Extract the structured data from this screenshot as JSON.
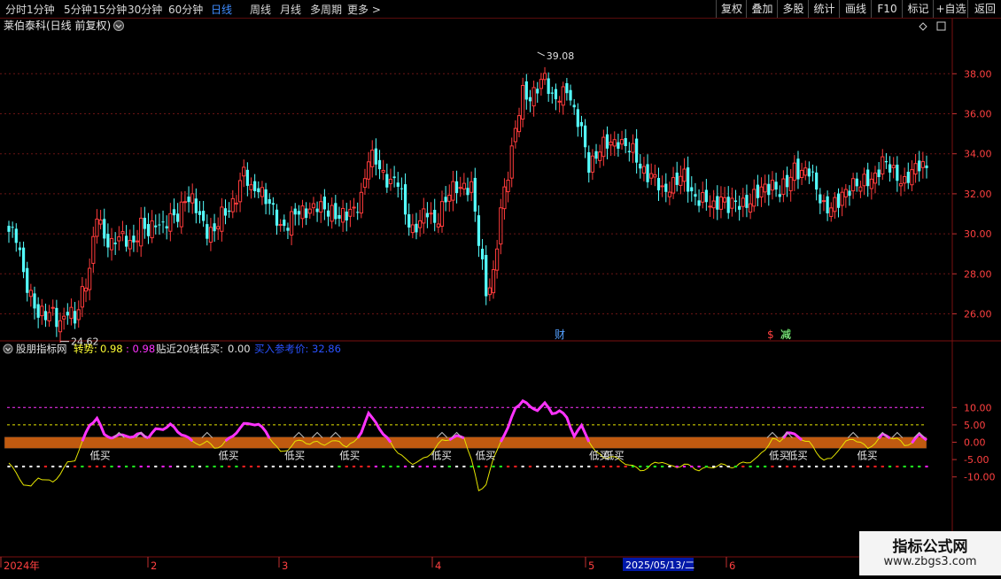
{
  "toolbar": {
    "periods": [
      "分时",
      "1分钟",
      "5分钟",
      "15分钟",
      "30分钟",
      "60分钟",
      "日线",
      "周线",
      "月线",
      "多周期",
      "更多 >"
    ],
    "active_period": "日线",
    "right_buttons": [
      "复权",
      "叠加",
      "多股",
      "统计",
      "画线",
      "F10",
      "标记",
      "+自选",
      "返回"
    ]
  },
  "stock_title": "莱伯泰科(日线 前复权)",
  "price_axis": {
    "ticks": [
      38.0,
      36.0,
      34.0,
      32.0,
      30.0,
      28.0,
      26.0
    ],
    "min": 24.6,
    "max": 39.2
  },
  "markers": {
    "high_label": "39.08",
    "low_label": "24.62",
    "event1": "财",
    "event2": "$",
    "event3": "减"
  },
  "indicator": {
    "name": "股朋指标网",
    "turn_label": "转势:",
    "turn_v1": "0.98",
    "turn_v2": ": 0.98",
    "near20_label": "贴近20线低买:",
    "near20_value": "0.00",
    "buy_ref_label": "买入参考价:",
    "buy_ref_value": "32.86",
    "axis_ticks": [
      10.0,
      5.0,
      0.0,
      -5.0,
      -10.0
    ],
    "buy_tag": "低买",
    "buy_tag_days": [
      24,
      59,
      77,
      92,
      117,
      129,
      160,
      164,
      209,
      214,
      233
    ]
  },
  "date_axis": {
    "labels": [
      "2024年",
      "2",
      "3",
      "4",
      "5",
      "6"
    ],
    "highlight": "2025/05/13/二"
  },
  "colors": {
    "up": "#ff3b3b",
    "down": "#54ffff",
    "turn_line": "#ff33ff",
    "thin_line": "#e6e600",
    "band": "#c05a10"
  },
  "watermark": {
    "title": "指标公式网",
    "url": "www.zbgs3.com"
  },
  "chart_data": {
    "type": "candlestick",
    "anchor_closes": [
      [
        0,
        30.1
      ],
      [
        2,
        29.7
      ],
      [
        4,
        28.1
      ],
      [
        6,
        27.0
      ],
      [
        8,
        25.8
      ],
      [
        10,
        25.9
      ],
      [
        12,
        26.3
      ],
      [
        14,
        25.4
      ],
      [
        16,
        26.0
      ],
      [
        18,
        25.8
      ],
      [
        20,
        27.2
      ],
      [
        22,
        28.0
      ],
      [
        24,
        31.0
      ],
      [
        26,
        30.0
      ],
      [
        28,
        29.4
      ],
      [
        30,
        29.7
      ],
      [
        32,
        29.8
      ],
      [
        34,
        29.6
      ],
      [
        36,
        30.3
      ],
      [
        38,
        30.0
      ],
      [
        40,
        30.8
      ],
      [
        42,
        30.3
      ],
      [
        44,
        30.6
      ],
      [
        46,
        31.0
      ],
      [
        48,
        31.9
      ],
      [
        50,
        31.5
      ],
      [
        52,
        30.8
      ],
      [
        54,
        30.3
      ],
      [
        56,
        30.1
      ],
      [
        58,
        30.8
      ],
      [
        60,
        31.3
      ],
      [
        62,
        32.0
      ],
      [
        64,
        33.0
      ],
      [
        66,
        32.1
      ],
      [
        68,
        32.5
      ],
      [
        70,
        31.7
      ],
      [
        72,
        31.0
      ],
      [
        74,
        30.4
      ],
      [
        76,
        30.6
      ],
      [
        78,
        30.9
      ],
      [
        80,
        31.0
      ],
      [
        82,
        31.4
      ],
      [
        84,
        31.4
      ],
      [
        86,
        31.0
      ],
      [
        88,
        31.2
      ],
      [
        90,
        31.0
      ],
      [
        92,
        30.8
      ],
      [
        94,
        31.1
      ],
      [
        96,
        32.0
      ],
      [
        98,
        33.8
      ],
      [
        100,
        33.5
      ],
      [
        102,
        33.0
      ],
      [
        104,
        32.7
      ],
      [
        106,
        32.5
      ],
      [
        108,
        31.0
      ],
      [
        110,
        30.3
      ],
      [
        112,
        30.6
      ],
      [
        114,
        31.0
      ],
      [
        116,
        30.6
      ],
      [
        118,
        31.4
      ],
      [
        120,
        31.9
      ],
      [
        122,
        32.3
      ],
      [
        124,
        32.5
      ],
      [
        126,
        32.3
      ],
      [
        128,
        29.5
      ],
      [
        130,
        27.2
      ],
      [
        132,
        28.0
      ],
      [
        134,
        31.0
      ],
      [
        136,
        33.0
      ],
      [
        138,
        35.5
      ],
      [
        140,
        37.0
      ],
      [
        142,
        36.5
      ],
      [
        144,
        37.5
      ],
      [
        146,
        38.0
      ],
      [
        148,
        36.5
      ],
      [
        150,
        36.8
      ],
      [
        152,
        37.5
      ],
      [
        154,
        36.0
      ],
      [
        156,
        35.0
      ],
      [
        158,
        33.5
      ],
      [
        160,
        34.0
      ],
      [
        162,
        34.3
      ],
      [
        164,
        34.5
      ],
      [
        166,
        34.8
      ],
      [
        168,
        34.3
      ],
      [
        170,
        34.0
      ],
      [
        172,
        33.5
      ],
      [
        174,
        33.0
      ],
      [
        176,
        32.6
      ],
      [
        178,
        32.1
      ],
      [
        180,
        32.5
      ],
      [
        182,
        32.6
      ],
      [
        184,
        32.8
      ],
      [
        186,
        32.1
      ],
      [
        188,
        31.8
      ],
      [
        190,
        31.5
      ],
      [
        192,
        31.3
      ],
      [
        194,
        32.0
      ],
      [
        196,
        31.3
      ],
      [
        198,
        31.4
      ],
      [
        200,
        31.6
      ],
      [
        202,
        31.7
      ],
      [
        204,
        31.9
      ],
      [
        206,
        32.3
      ],
      [
        208,
        32.6
      ],
      [
        210,
        32.0
      ],
      [
        212,
        32.4
      ],
      [
        214,
        33.4
      ],
      [
        216,
        33.1
      ],
      [
        218,
        33.0
      ],
      [
        220,
        32.3
      ],
      [
        222,
        31.5
      ],
      [
        224,
        31.2
      ],
      [
        226,
        31.5
      ],
      [
        228,
        32.3
      ],
      [
        230,
        32.5
      ],
      [
        232,
        32.3
      ],
      [
        234,
        32.7
      ],
      [
        236,
        33.0
      ],
      [
        238,
        33.5
      ],
      [
        240,
        33.2
      ],
      [
        242,
        33.0
      ],
      [
        244,
        32.6
      ],
      [
        246,
        32.9
      ],
      [
        248,
        33.5
      ],
      [
        250,
        33.5
      ]
    ],
    "high": 39.08,
    "low": 24.62,
    "indicator_thin_anchors": [
      [
        0,
        -6
      ],
      [
        2,
        -9
      ],
      [
        4,
        -12
      ],
      [
        6,
        -13
      ],
      [
        8,
        -10
      ],
      [
        10,
        -11
      ],
      [
        12,
        -11.5
      ],
      [
        14,
        -9
      ],
      [
        16,
        -6
      ],
      [
        18,
        -5
      ],
      [
        20,
        0
      ],
      [
        22,
        5
      ],
      [
        24,
        7
      ],
      [
        26,
        2
      ],
      [
        28,
        1.5
      ],
      [
        30,
        1.8
      ],
      [
        32,
        2
      ],
      [
        34,
        1.5
      ],
      [
        36,
        2.5
      ],
      [
        38,
        1.5
      ],
      [
        40,
        3.5
      ],
      [
        42,
        4
      ],
      [
        44,
        5
      ],
      [
        46,
        3
      ],
      [
        48,
        2
      ],
      [
        50,
        0
      ],
      [
        52,
        -0.5
      ],
      [
        54,
        0
      ],
      [
        56,
        -1.5
      ],
      [
        58,
        -1
      ],
      [
        60,
        1
      ],
      [
        62,
        3
      ],
      [
        64,
        5
      ],
      [
        66,
        5.5
      ],
      [
        68,
        5
      ],
      [
        70,
        3
      ],
      [
        72,
        0
      ],
      [
        74,
        -3
      ],
      [
        76,
        -2
      ],
      [
        78,
        0
      ],
      [
        80,
        0.5
      ],
      [
        82,
        -0.5
      ],
      [
        84,
        0
      ],
      [
        86,
        -0.5
      ],
      [
        88,
        0
      ],
      [
        90,
        0.5
      ],
      [
        92,
        -1.5
      ],
      [
        94,
        0
      ],
      [
        96,
        3
      ],
      [
        98,
        8
      ],
      [
        100,
        6
      ],
      [
        102,
        2
      ],
      [
        104,
        0
      ],
      [
        106,
        -3
      ],
      [
        108,
        -5
      ],
      [
        110,
        -6
      ],
      [
        112,
        -5.5
      ],
      [
        114,
        -4
      ],
      [
        116,
        -2
      ],
      [
        118,
        0.5
      ],
      [
        120,
        1
      ],
      [
        122,
        1.5
      ],
      [
        124,
        1.5
      ],
      [
        126,
        -5
      ],
      [
        128,
        -14
      ],
      [
        130,
        -12
      ],
      [
        132,
        -5
      ],
      [
        134,
        0.5
      ],
      [
        136,
        4
      ],
      [
        138,
        10
      ],
      [
        140,
        12
      ],
      [
        142,
        10
      ],
      [
        144,
        9.5
      ],
      [
        146,
        11
      ],
      [
        148,
        8.5
      ],
      [
        150,
        9
      ],
      [
        152,
        7
      ],
      [
        154,
        2
      ],
      [
        156,
        4.5
      ],
      [
        158,
        0.5
      ],
      [
        160,
        -3
      ],
      [
        162,
        -4.5
      ],
      [
        164,
        -4
      ],
      [
        166,
        -5
      ],
      [
        168,
        -6
      ],
      [
        170,
        -7
      ],
      [
        172,
        -8
      ],
      [
        174,
        -7.5
      ],
      [
        176,
        -6
      ],
      [
        178,
        -5.5
      ],
      [
        180,
        -7
      ],
      [
        182,
        -7
      ],
      [
        184,
        -6.5
      ],
      [
        186,
        -7
      ],
      [
        188,
        -8
      ],
      [
        190,
        -7.5
      ],
      [
        192,
        -7
      ],
      [
        194,
        -6.5
      ],
      [
        196,
        -7
      ],
      [
        198,
        -7
      ],
      [
        200,
        -6
      ],
      [
        202,
        -5.5
      ],
      [
        204,
        -4.5
      ],
      [
        206,
        -2
      ],
      [
        208,
        1
      ],
      [
        210,
        0
      ],
      [
        212,
        3
      ],
      [
        214,
        2
      ],
      [
        216,
        1
      ],
      [
        218,
        0
      ],
      [
        220,
        -3
      ],
      [
        222,
        -5
      ],
      [
        224,
        -5
      ],
      [
        226,
        -2
      ],
      [
        228,
        0
      ],
      [
        230,
        1
      ],
      [
        232,
        0
      ],
      [
        234,
        -2
      ],
      [
        236,
        0
      ],
      [
        238,
        2
      ],
      [
        240,
        1.5
      ],
      [
        242,
        1
      ],
      [
        244,
        -1
      ],
      [
        246,
        0
      ],
      [
        248,
        2
      ],
      [
        250,
        1
      ]
    ]
  }
}
